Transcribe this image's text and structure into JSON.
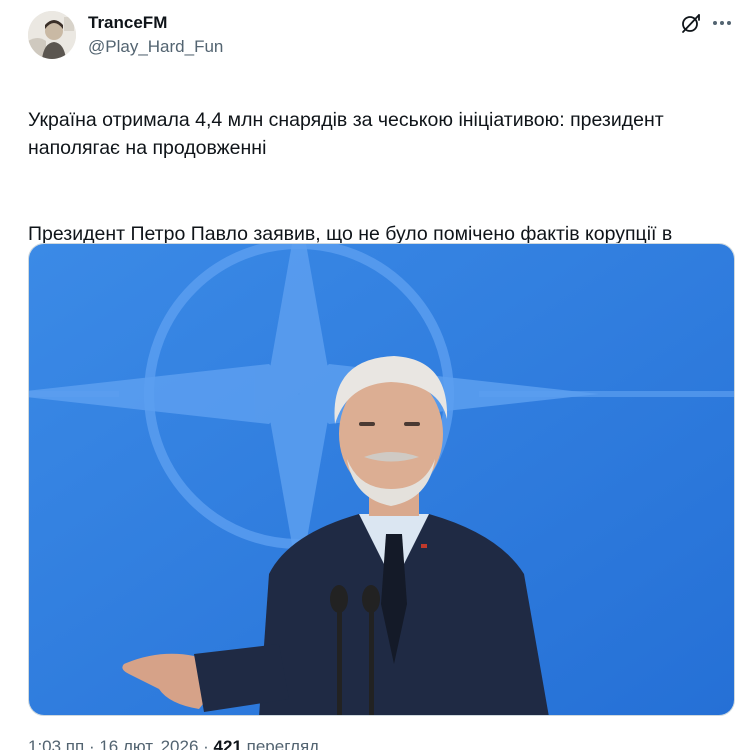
{
  "author": {
    "display_name": "TranceFM",
    "handle": "@Play_Hard_Fun"
  },
  "post": {
    "paragraphs": [
      "Україна отримала 4,4 млн снарядів за чеською ініціативою: президент наполягає на продовженні",
      "Президент Петро Павло заявив, що не було помічено фактів корупції в рамках чеської ініціативи - вона допомагає ЗСУ тримати оборону"
    ]
  },
  "meta": {
    "timestamp": "1:03 пп · 16 лют. 2026",
    "separator": " · ",
    "views_count": "421",
    "views_label": " перегляд"
  },
  "icons": {
    "grok": "grok-icon",
    "more": "more-icon"
  },
  "colors": {
    "text": "#0f1419",
    "secondary": "#536471",
    "image_background": "#2f7fe0"
  }
}
